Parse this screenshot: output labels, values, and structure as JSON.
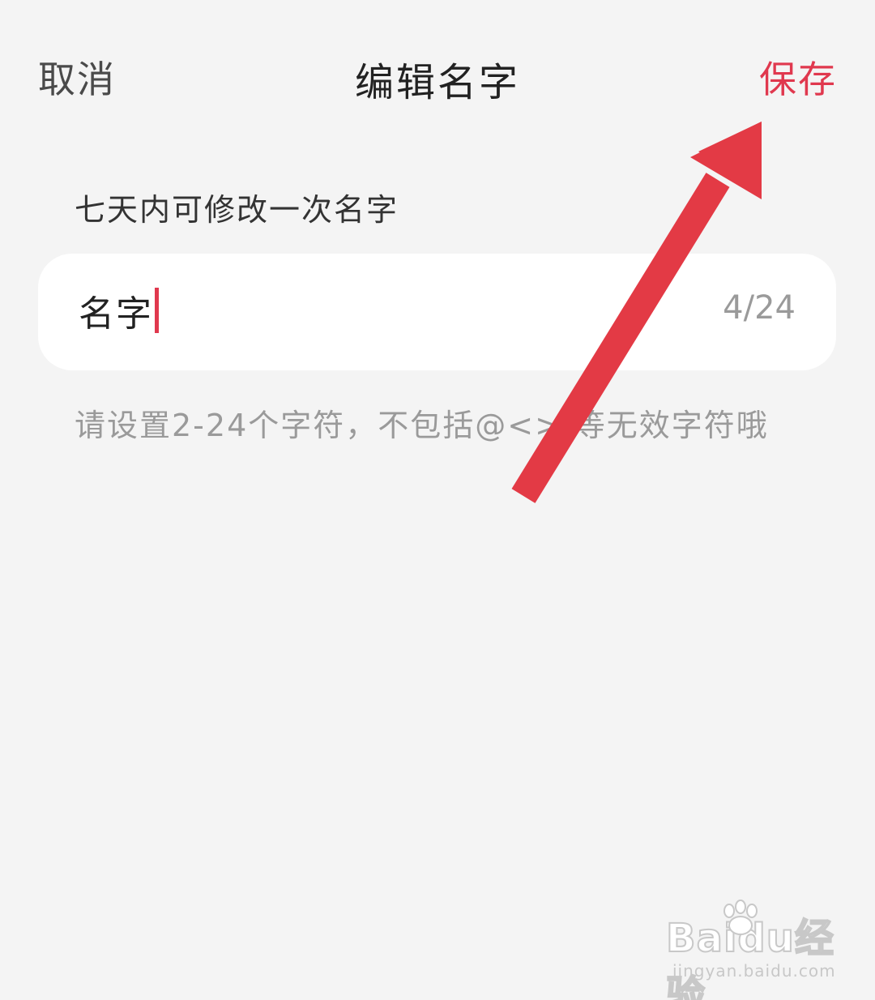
{
  "nav": {
    "cancel_label": "取消",
    "title": "编辑名字",
    "save_label": "保存"
  },
  "notice": "七天内可修改一次名字",
  "name_input": {
    "value": "名字",
    "counter": "4/24"
  },
  "hint": "请设置2-24个字符，不包括@<>/等无效字符哦",
  "watermark": {
    "logo": "Baidu经验",
    "url": "jingyan.baidu.com"
  },
  "colors": {
    "accent": "#e0384e",
    "background": "#f4f4f4",
    "annotation_arrow": "#e33a45"
  }
}
